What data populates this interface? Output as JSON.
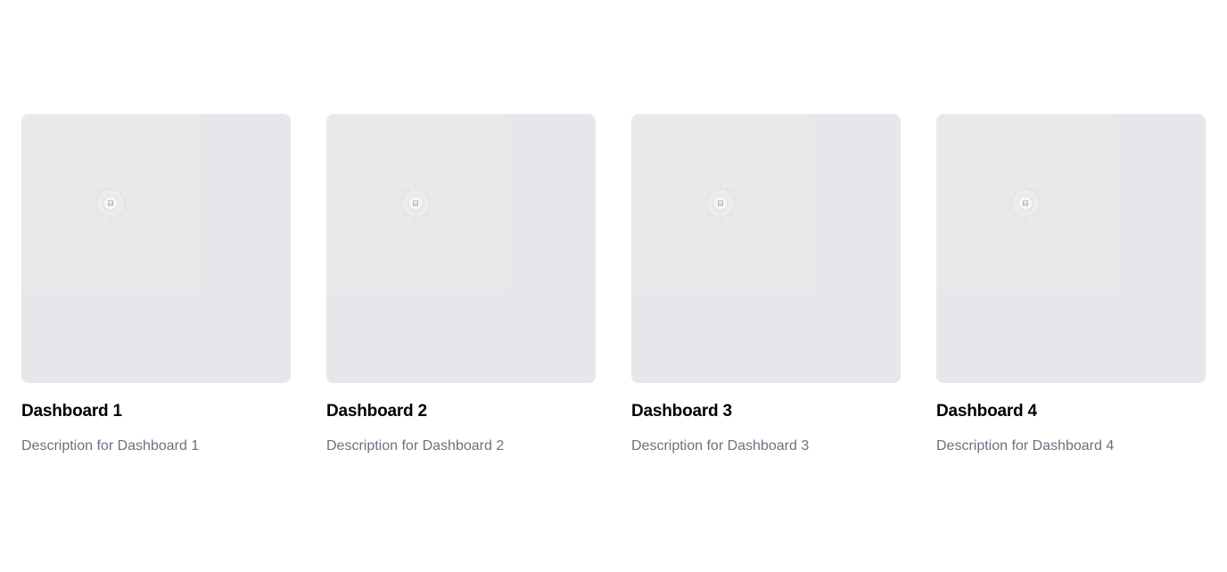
{
  "cards": [
    {
      "title": "Dashboard 1",
      "description": "Description for Dashboard 1",
      "thumbnail_icon": "image-placeholder-icon"
    },
    {
      "title": "Dashboard 2",
      "description": "Description for Dashboard 2",
      "thumbnail_icon": "image-placeholder-icon"
    },
    {
      "title": "Dashboard 3",
      "description": "Description for Dashboard 3",
      "thumbnail_icon": "image-placeholder-icon"
    },
    {
      "title": "Dashboard 4",
      "description": "Description for Dashboard 4",
      "thumbnail_icon": "image-placeholder-icon"
    }
  ],
  "colors": {
    "thumbnail_bg": "#e5e7eb",
    "thumbnail_inner": "#e9e9e9",
    "title": "#000000",
    "description": "#6b7280"
  }
}
